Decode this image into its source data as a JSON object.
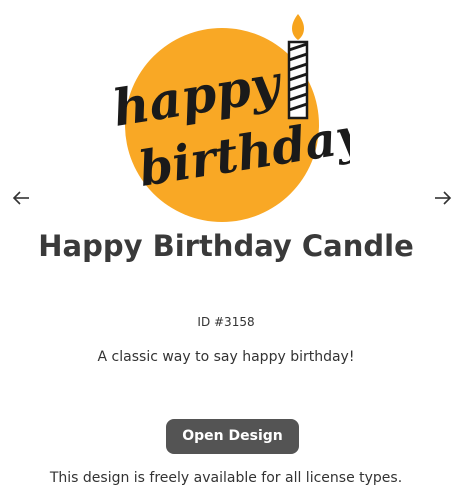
{
  "design": {
    "artwork_text_line1": "happy",
    "artwork_text_line2": "birthday",
    "title": "Happy Birthday Candle",
    "id_label": "ID #3158",
    "description": "A classic way to say happy birthday!",
    "open_button_label": "Open Design",
    "license_note": "This design is freely available for all license types."
  },
  "colors": {
    "circle": "#f9a825",
    "flame": "#f7a41d",
    "lettering": "#1a1a1a",
    "button": "#545454",
    "title": "#3a3a3a"
  },
  "icons": {
    "prev": "arrow-left-icon",
    "next": "arrow-right-icon"
  }
}
